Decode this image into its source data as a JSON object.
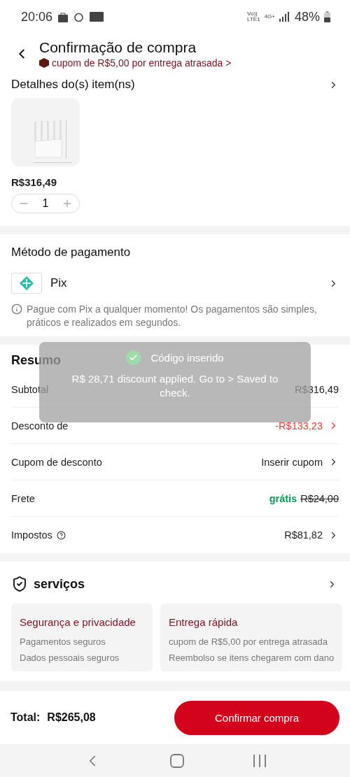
{
  "status_bar": {
    "time": "20:06",
    "network_labels": [
      "Vo))",
      "LTE1",
      "4G+"
    ],
    "battery": "48%"
  },
  "header": {
    "title": "Confirmação de compra",
    "banner": "cupom de R$5,00 por entrega atrasada >"
  },
  "item_details": {
    "title": "Detalhes do(s) item(ns)",
    "item": {
      "kind": "picture",
      "price": "R$316,49",
      "quantity": "1"
    }
  },
  "payment": {
    "title": "Método de pagamento",
    "method": "Pix",
    "note": "Pague com Pix a qualquer momento! Os pagamentos são simples, práticos e realizados em segundos."
  },
  "summary": {
    "title": "Resumo",
    "rows": [
      {
        "kind": "plain",
        "label": "Subtotal",
        "value": "R$316,49"
      },
      {
        "kind": "discount",
        "label": "Desconto de",
        "value": "-R$133,23"
      },
      {
        "kind": "link",
        "label": "Cupom de desconto",
        "value": "Inserir cupom"
      },
      {
        "kind": "shipping",
        "label": "Frete",
        "free": "grátis",
        "value": "R$24,00"
      },
      {
        "kind": "tax",
        "label": "Impostos",
        "value": "R$81,82"
      }
    ]
  },
  "services": {
    "title": "serviços",
    "cards": [
      {
        "title": "Segurança e privacidade",
        "lines": [
          "Pagamentos seguros",
          "Dados pessoais seguros"
        ]
      },
      {
        "title": "Entrega rápida",
        "lines": [
          "cupom de R$5,00 por entrega atrasada",
          "Reembolso se itens chegarem com dano"
        ]
      }
    ]
  },
  "footer": {
    "total_label": "Total:",
    "total": "R$265,08",
    "button": "Confirmar compra"
  },
  "toast": {
    "title": "Código inserido",
    "message": "R$ 28,71 discount applied. Go to > Saved to check."
  }
}
